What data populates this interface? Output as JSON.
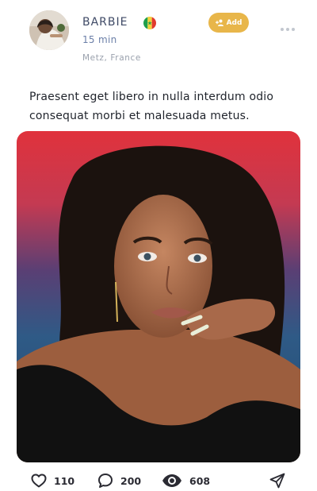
{
  "post": {
    "user": {
      "name": "BARBIE",
      "flag_icon": "senegal-flag-icon",
      "time_ago": "15 min",
      "location": "Metz, France"
    },
    "add_button": {
      "label": "Add",
      "icon": "add-user-icon",
      "color": "#e8b64a"
    },
    "more_icon": "more-horizontal-icon",
    "caption": "Praesent eget libero in nulla interdum odio consequat morbi et malesuada metus.",
    "stats": {
      "likes": "110",
      "comments": "200",
      "views": "608"
    },
    "icons": {
      "like": "heart-icon",
      "comment": "comment-icon",
      "views": "eye-icon",
      "share": "send-icon"
    }
  }
}
